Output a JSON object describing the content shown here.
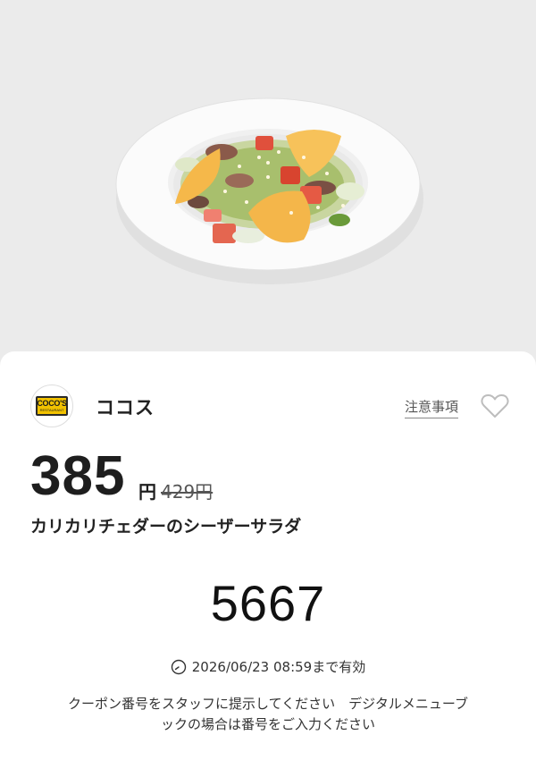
{
  "hero": {
    "image_name": "caesar-salad-photo"
  },
  "store": {
    "name": "ココス",
    "logo_text": "COCO'S",
    "logo_subtext": "RESTAURANT",
    "logo_color": "#f2c200"
  },
  "actions": {
    "notes_label": "注意事項",
    "favorite_icon": "heart-icon"
  },
  "price": {
    "current": "385",
    "unit": "円",
    "original": "429円"
  },
  "item": {
    "title": "カリカリチェダーのシーザーサラダ"
  },
  "coupon": {
    "code": "5667"
  },
  "expiry": {
    "text": "2026/06/23 08:59まで有効",
    "icon": "clock-icon"
  },
  "instructions": {
    "line1": "クーポン番号をスタッフに提示してください　デジタルメニューブ",
    "line2": "ックの場合は番号をご入力ください"
  }
}
